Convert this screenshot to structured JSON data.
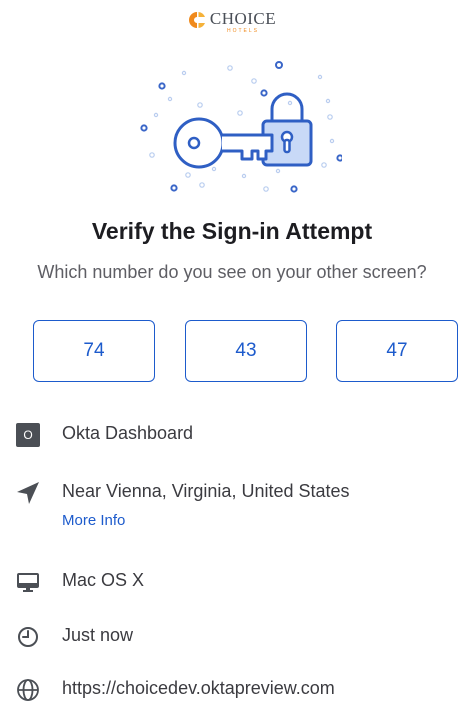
{
  "brand": {
    "name": "CHOICE",
    "sub": "HOTELS"
  },
  "heading": {
    "title": "Verify the Sign-in Attempt",
    "prompt": "Which number do you see on your other screen?"
  },
  "choices": [
    "74",
    "43",
    "47"
  ],
  "details": {
    "app": {
      "badge": "O",
      "name": "Okta Dashboard"
    },
    "location": {
      "text": "Near Vienna, Virginia, United States",
      "link": "More Info"
    },
    "device": {
      "text": "Mac OS X"
    },
    "time": {
      "text": "Just now"
    },
    "url": {
      "text": "https://choicedev.oktapreview.com"
    }
  },
  "colors": {
    "accent": "#1d5bcc",
    "brand_orange": "#f08a1c",
    "illustration_fill": "#c8d9f7"
  },
  "icons": {
    "app": "okta-app-icon",
    "location": "location-arrow-icon",
    "device": "desktop-icon",
    "time": "clock-icon",
    "url": "globe-icon"
  }
}
